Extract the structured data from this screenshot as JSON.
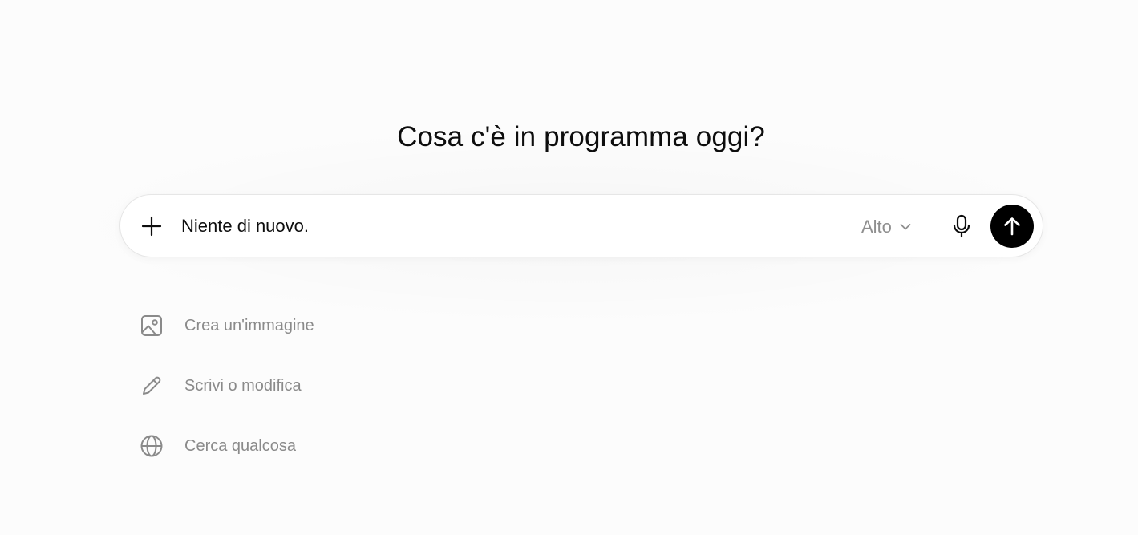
{
  "header": {
    "title": "Cosa c'è in programma oggi?"
  },
  "composer": {
    "add_icon": "plus-icon",
    "input_value": "Niente di nuovo.",
    "model_label": "Alto",
    "model_icon": "chevron-down-icon",
    "mic_icon": "microphone-icon",
    "send_icon": "arrow-up-icon",
    "send_button_color": "#000000"
  },
  "suggestions": [
    {
      "label": "Crea un'immagine",
      "icon": "image-icon"
    },
    {
      "label": "Scrivi o modifica",
      "icon": "pencil-icon"
    },
    {
      "label": "Cerca qualcosa",
      "icon": "globe-icon"
    }
  ]
}
